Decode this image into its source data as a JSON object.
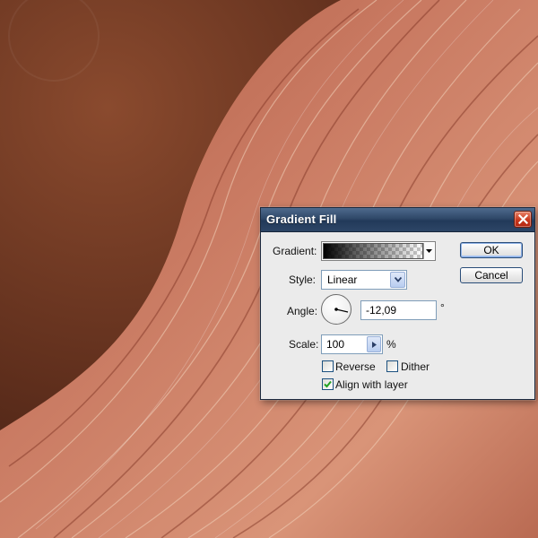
{
  "dialog": {
    "title": "Gradient Fill",
    "gradient_label": "Gradient:",
    "style_label": "Style:",
    "style_value": "Linear",
    "angle_label": "Angle:",
    "angle_value": "-12,09",
    "angle_unit": "°",
    "scale_label": "Scale:",
    "scale_value": "100",
    "scale_unit": "%",
    "reverse_label": "Reverse",
    "reverse_checked": false,
    "dither_label": "Dither",
    "dither_checked": false,
    "align_label": "Align with layer",
    "align_checked": true,
    "ok_label": "OK",
    "cancel_label": "Cancel"
  },
  "colors": {
    "titlebar": "#2f4868",
    "close": "#c8371c",
    "dialog_bg": "#ebebeb",
    "checkmark": "#21a121"
  },
  "icons": {
    "close": "close-x-icon",
    "dropdown": "chevron-down-icon",
    "stepper": "triangle-right-icon",
    "check": "checkmark-icon"
  }
}
